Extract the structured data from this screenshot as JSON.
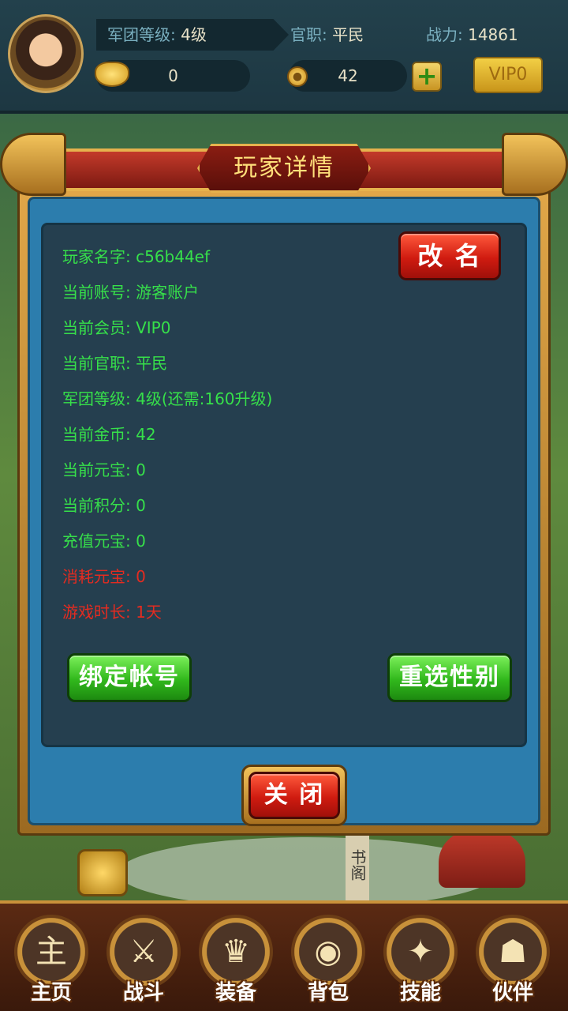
{
  "hud": {
    "legion_level_label": "军团等级:",
    "legion_level_value": "4级",
    "office_label": "官职:",
    "office_value": "平民",
    "power_label": "战力:",
    "power_value": "14861",
    "ingot_count": "0",
    "gold_count": "42",
    "plus_symbol": "+",
    "vip_label": "VIP0"
  },
  "world": {
    "sign_text": "书阁"
  },
  "dialog": {
    "title": "玩家详情",
    "rename_button": "改 名",
    "lines": [
      {
        "text": "玩家名字: c56b44ef",
        "color": "#36e04a"
      },
      {
        "text": "当前账号: 游客账户",
        "color": "#36e04a"
      },
      {
        "text": "当前会员: VIP0",
        "color": "#36e04a"
      },
      {
        "text": "当前官职: 平民",
        "color": "#36e04a"
      },
      {
        "text": "军团等级: 4级(还需:160升级)",
        "color": "#36e04a"
      },
      {
        "text": "当前金币: 42",
        "color": "#36e04a"
      },
      {
        "text": "当前元宝: 0",
        "color": "#36e04a"
      },
      {
        "text": "当前积分: 0",
        "color": "#36e04a"
      },
      {
        "text": "充值元宝: 0",
        "color": "#36e04a"
      },
      {
        "text": "消耗元宝: 0",
        "color": "#e52b20"
      },
      {
        "text": "游戏时长: 1天",
        "color": "#e52b20"
      }
    ],
    "bind_account_button": "绑定帐号",
    "reselect_gender_button": "重选性别",
    "close_button": "关 闭"
  },
  "nav": {
    "items": [
      {
        "label": "主页",
        "icon": "home-icon",
        "glyph": "主"
      },
      {
        "label": "战斗",
        "icon": "battle-icon",
        "glyph": "⚔"
      },
      {
        "label": "装备",
        "icon": "equipment-icon",
        "glyph": "♛"
      },
      {
        "label": "背包",
        "icon": "backpack-icon",
        "glyph": "◉"
      },
      {
        "label": "技能",
        "icon": "skill-icon",
        "glyph": "✦"
      },
      {
        "label": "伙伴",
        "icon": "partner-icon",
        "glyph": "☗"
      }
    ]
  }
}
